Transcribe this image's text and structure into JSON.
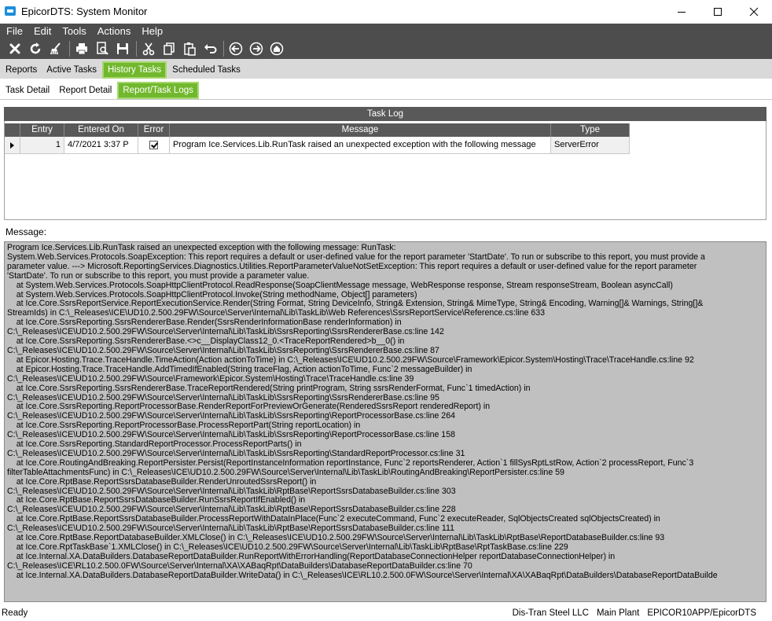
{
  "window": {
    "title": "EpicorDTS: System Monitor"
  },
  "menu": [
    "File",
    "Edit",
    "Tools",
    "Actions",
    "Help"
  ],
  "toolbar": {
    "icons": [
      "close-icon",
      "refresh-icon",
      "clear-icon",
      "print-icon",
      "print-preview-icon",
      "save-icon",
      "cut-icon",
      "copy-icon",
      "paste-icon",
      "undo-icon",
      "back-icon",
      "forward-icon",
      "home-icon"
    ]
  },
  "tabs": [
    "Reports",
    "Active Tasks",
    "History Tasks",
    "Scheduled Tasks"
  ],
  "subtabs": [
    "Task Detail",
    "Report Detail",
    "Report/Task Logs"
  ],
  "task_log": {
    "title": "Task Log",
    "columns": [
      "Entry",
      "Entered On",
      "Error",
      "Message",
      "Type"
    ],
    "rows": [
      {
        "entry": "1",
        "entered_on": "4/7/2021 3:37 P",
        "error": true,
        "message": "Program Ice.Services.Lib.RunTask raised an unexpected exception with the following message",
        "type": "ServerError"
      }
    ]
  },
  "message": {
    "label": "Message:",
    "lines": [
      "Program Ice.Services.Lib.RunTask raised an unexpected exception with the following message: RunTask:",
      "System.Web.Services.Protocols.SoapException: This report requires a default or user-defined value for the report parameter 'StartDate'. To run or subscribe to this report, you must provide a",
      "parameter value. ---> Microsoft.ReportingServices.Diagnostics.Utilities.ReportParameterValueNotSetException: This report requires a default or user-defined value for the report parameter",
      "'StartDate'. To run or subscribe to this report, you must provide a parameter value.",
      "    at System.Web.Services.Protocols.SoapHttpClientProtocol.ReadResponse(SoapClientMessage message, WebResponse response, Stream responseStream, Boolean asyncCall)",
      "    at System.Web.Services.Protocols.SoapHttpClientProtocol.Invoke(String methodName, Object[] parameters)",
      "    at Ice.Core.SsrsReportService.ReportExecutionService.Render(String Format, String DeviceInfo, String& Extension, String& MimeType, String& Encoding, Warning[]& Warnings, String[]&",
      "StreamIds) in C:\\_Releases\\ICE\\UD10.2.500.29FW\\Source\\Server\\Internal\\Lib\\TaskLib\\Web References\\SsrsReportService\\Reference.cs:line 633",
      "    at Ice.Core.SsrsReporting.SsrsRendererBase.Render(SsrsRenderInformationBase renderInformation) in",
      "C:\\_Releases\\ICE\\UD10.2.500.29FW\\Source\\Server\\Internal\\Lib\\TaskLib\\SsrsReporting\\SsrsRendererBase.cs:line 142",
      "    at Ice.Core.SsrsReporting.SsrsRendererBase.<>c__DisplayClass12_0.<TraceReportRendered>b__0() in",
      "C:\\_Releases\\ICE\\UD10.2.500.29FW\\Source\\Server\\Internal\\Lib\\TaskLib\\SsrsReporting\\SsrsRendererBase.cs:line 87",
      "    at Epicor.Hosting.Trace.TraceHandle.TimeAction(Action actionToTime) in C:\\_Releases\\ICE\\UD10.2.500.29FW\\Source\\Framework\\Epicor.System\\Hosting\\Trace\\TraceHandle.cs:line 92",
      "    at Epicor.Hosting.Trace.TraceHandle.AddTimedIfEnabled(String traceFlag, Action actionToTime, Func`2 messageBuilder) in",
      "C:\\_Releases\\ICE\\UD10.2.500.29FW\\Source\\Framework\\Epicor.System\\Hosting\\Trace\\TraceHandle.cs:line 39",
      "    at Ice.Core.SsrsReporting.SsrsRendererBase.TraceReportRendered(String printProgram, String ssrsRenderFormat, Func`1 timedAction) in",
      "C:\\_Releases\\ICE\\UD10.2.500.29FW\\Source\\Server\\Internal\\Lib\\TaskLib\\SsrsReporting\\SsrsRendererBase.cs:line 95",
      "    at Ice.Core.SsrsReporting.ReportProcessorBase.RenderReportForPreviewOrGenerate(RenderedSsrsReport renderedReport) in",
      "C:\\_Releases\\ICE\\UD10.2.500.29FW\\Source\\Server\\Internal\\Lib\\TaskLib\\SsrsReporting\\ReportProcessorBase.cs:line 264",
      "    at Ice.Core.SsrsReporting.ReportProcessorBase.ProcessReportPart(String reportLocation) in",
      "C:\\_Releases\\ICE\\UD10.2.500.29FW\\Source\\Server\\Internal\\Lib\\TaskLib\\SsrsReporting\\ReportProcessorBase.cs:line 158",
      "    at Ice.Core.SsrsReporting.StandardReportProcessor.ProcessReportParts() in",
      "C:\\_Releases\\ICE\\UD10.2.500.29FW\\Source\\Server\\Internal\\Lib\\TaskLib\\SsrsReporting\\StandardReportProcessor.cs:line 31",
      "    at Ice.Core.RoutingAndBreaking.ReportPersister.Persist(ReportInstanceInformation reportInstance, Func`2 reportsRenderer, Action`1 fillSysRptLstRow, Action`2 processReport, Func`3",
      "filterTableAttachmentsFunc) in C:\\_Releases\\ICE\\UD10.2.500.29FW\\Source\\Server\\Internal\\Lib\\TaskLib\\RoutingAndBreaking\\ReportPersister.cs:line 59",
      "    at Ice.Core.RptBase.ReportSsrsDatabaseBuilder.RenderUnroutedSsrsReport() in",
      "C:\\_Releases\\ICE\\UD10.2.500.29FW\\Source\\Server\\Internal\\Lib\\TaskLib\\RptBase\\ReportSsrsDatabaseBuilder.cs:line 303",
      "    at Ice.Core.RptBase.ReportSsrsDatabaseBuilder.RunSsrsReportIfEnabled() in",
      "C:\\_Releases\\ICE\\UD10.2.500.29FW\\Source\\Server\\Internal\\Lib\\TaskLib\\RptBase\\ReportSsrsDatabaseBuilder.cs:line 228",
      "    at Ice.Core.RptBase.ReportSsrsDatabaseBuilder.ProcessReportWithDataInPlace(Func`2 executeCommand, Func`2 executeReader, SqlObjectsCreated sqlObjectsCreated) in",
      "C:\\_Releases\\ICE\\UD10.2.500.29FW\\Source\\Server\\Internal\\Lib\\TaskLib\\RptBase\\ReportSsrsDatabaseBuilder.cs:line 111",
      "    at Ice.Core.RptBase.ReportDatabaseBuilder.XMLClose() in C:\\_Releases\\ICE\\UD10.2.500.29FW\\Source\\Server\\Internal\\Lib\\TaskLib\\RptBase\\ReportDatabaseBuilder.cs:line 93",
      "    at Ice.Core.RptTaskBase`1.XMLClose() in C:\\_Releases\\ICE\\UD10.2.500.29FW\\Source\\Server\\Internal\\Lib\\TaskLib\\RptBase\\RptTaskBase.cs:line 229",
      "    at Ice.Internal.XA.DataBuilders.DatabaseReportDataBuilder.RunReportWithErrorHandling(ReportDatabaseConnectionHelper reportDatabaseConnectionHelper) in",
      "C:\\_Releases\\ICE\\RL10.2.500.0FW\\Source\\Server\\Internal\\XA\\XABaqRpt\\DataBuilders\\DatabaseReportDataBuilder.cs:line 70",
      "    at Ice.Internal.XA.DataBuilders.DatabaseReportDataBuilder.WriteData() in C:\\_Releases\\ICE\\RL10.2.500.0FW\\Source\\Server\\Internal\\XA\\XABaqRpt\\DataBuilders\\DatabaseReportDataBuilde"
    ]
  },
  "status": {
    "left": "Ready",
    "company": "Dis-Tran Steel LLC",
    "plant": "Main Plant",
    "server": "EPICOR10APP/EpicorDTS"
  }
}
